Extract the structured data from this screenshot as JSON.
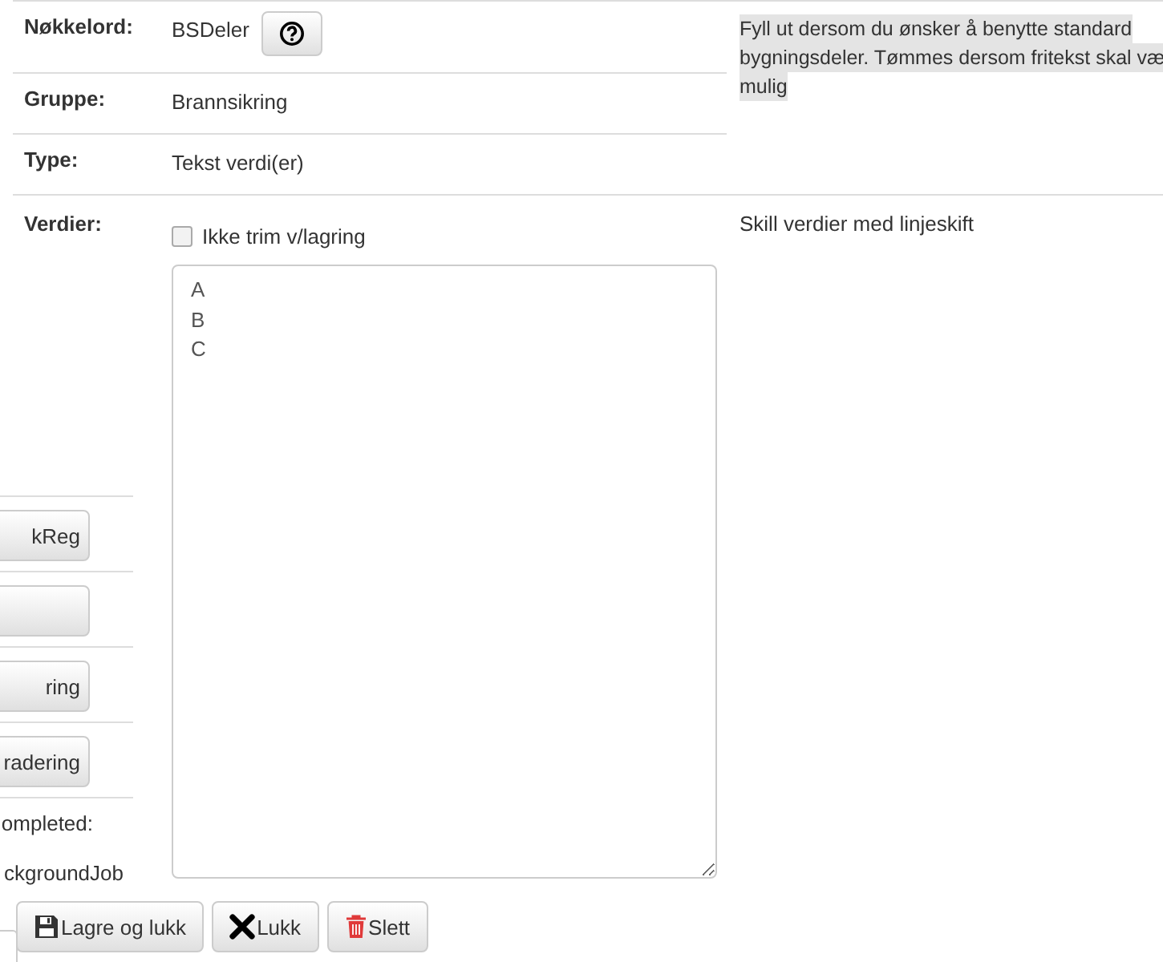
{
  "form": {
    "rows": [
      {
        "kind": "keyword",
        "label": "Nøkkelord:",
        "value": "BSDeler"
      },
      {
        "kind": "text",
        "label": "Gruppe:",
        "value": "Brannsikring"
      },
      {
        "kind": "text",
        "label": "Type:",
        "value": "Tekst verdi(er)"
      }
    ],
    "help_lines": [
      "Fyll ut dersom du ønsker å benytte standard",
      "bygningsdeler. Tømmes dersom fritekst skal væ",
      "mulig"
    ],
    "values": {
      "label": "Verdier:",
      "no_trim": {
        "label": "Ikke trim v/lagring",
        "checked": false
      },
      "text": "A\nB\nC",
      "help": "Skill verdier med linjeskift"
    }
  },
  "background_items": [
    {
      "kind": "button",
      "label": "kReg"
    },
    {
      "kind": "button"
    },
    {
      "kind": "button",
      "label": "ring"
    },
    {
      "kind": "button",
      "label": "radering"
    },
    {
      "kind": "text",
      "label": "ompleted:"
    },
    {
      "kind": "text",
      "label": "ckgroundJob"
    }
  ],
  "buttons": [
    {
      "kind": "save",
      "label": "Lagre og lukk"
    },
    {
      "kind": "close",
      "label": "Lukk"
    },
    {
      "kind": "delete",
      "label": "Slett"
    }
  ]
}
